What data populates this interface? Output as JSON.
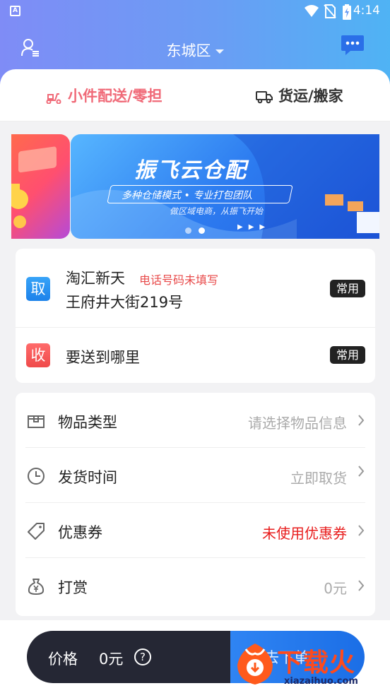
{
  "status_bar": {
    "time": "4:14",
    "notification_badge": "A"
  },
  "header": {
    "city": "东城区"
  },
  "tabs": [
    {
      "label": "小件配送/零担",
      "active": true
    },
    {
      "label": "货运/搬家",
      "active": false
    }
  ],
  "banner": {
    "title": "振飞云仓配",
    "subtitle": "多种仓储模式 • 专业打包团队",
    "tagline": "做区域电商，从振飞开始",
    "dots": 2,
    "active_dot": 1
  },
  "pickup": {
    "tag": "取",
    "name": "淘汇新天",
    "warning": "电话号码未填写",
    "address": "王府井大街219号",
    "common_label": "常用"
  },
  "delivery": {
    "tag": "收",
    "placeholder": "要送到哪里",
    "common_label": "常用"
  },
  "options": [
    {
      "icon": "box-icon",
      "label": "物品类型",
      "value": "请选择物品信息",
      "highlight": false
    },
    {
      "icon": "clock-icon",
      "label": "发货时间",
      "value": "立即取货",
      "highlight": false
    },
    {
      "icon": "coupon-tag-icon",
      "label": "优惠券",
      "value": "未使用优惠券",
      "highlight": true
    },
    {
      "icon": "money-bag-icon",
      "label": "打赏",
      "value": "0元",
      "highlight": false
    }
  ],
  "price_bar": {
    "label": "价格",
    "value": "0元",
    "help": "?"
  },
  "order_button": {
    "label": "去下单"
  },
  "watermark": {
    "brand": "下载火",
    "url": "xiazaihuo.com"
  },
  "colors": {
    "accent_pink": "#f06a78",
    "brand_blue": "#1b6ee6",
    "warning_red": "#e84a4a",
    "dark_bar": "#252734"
  }
}
